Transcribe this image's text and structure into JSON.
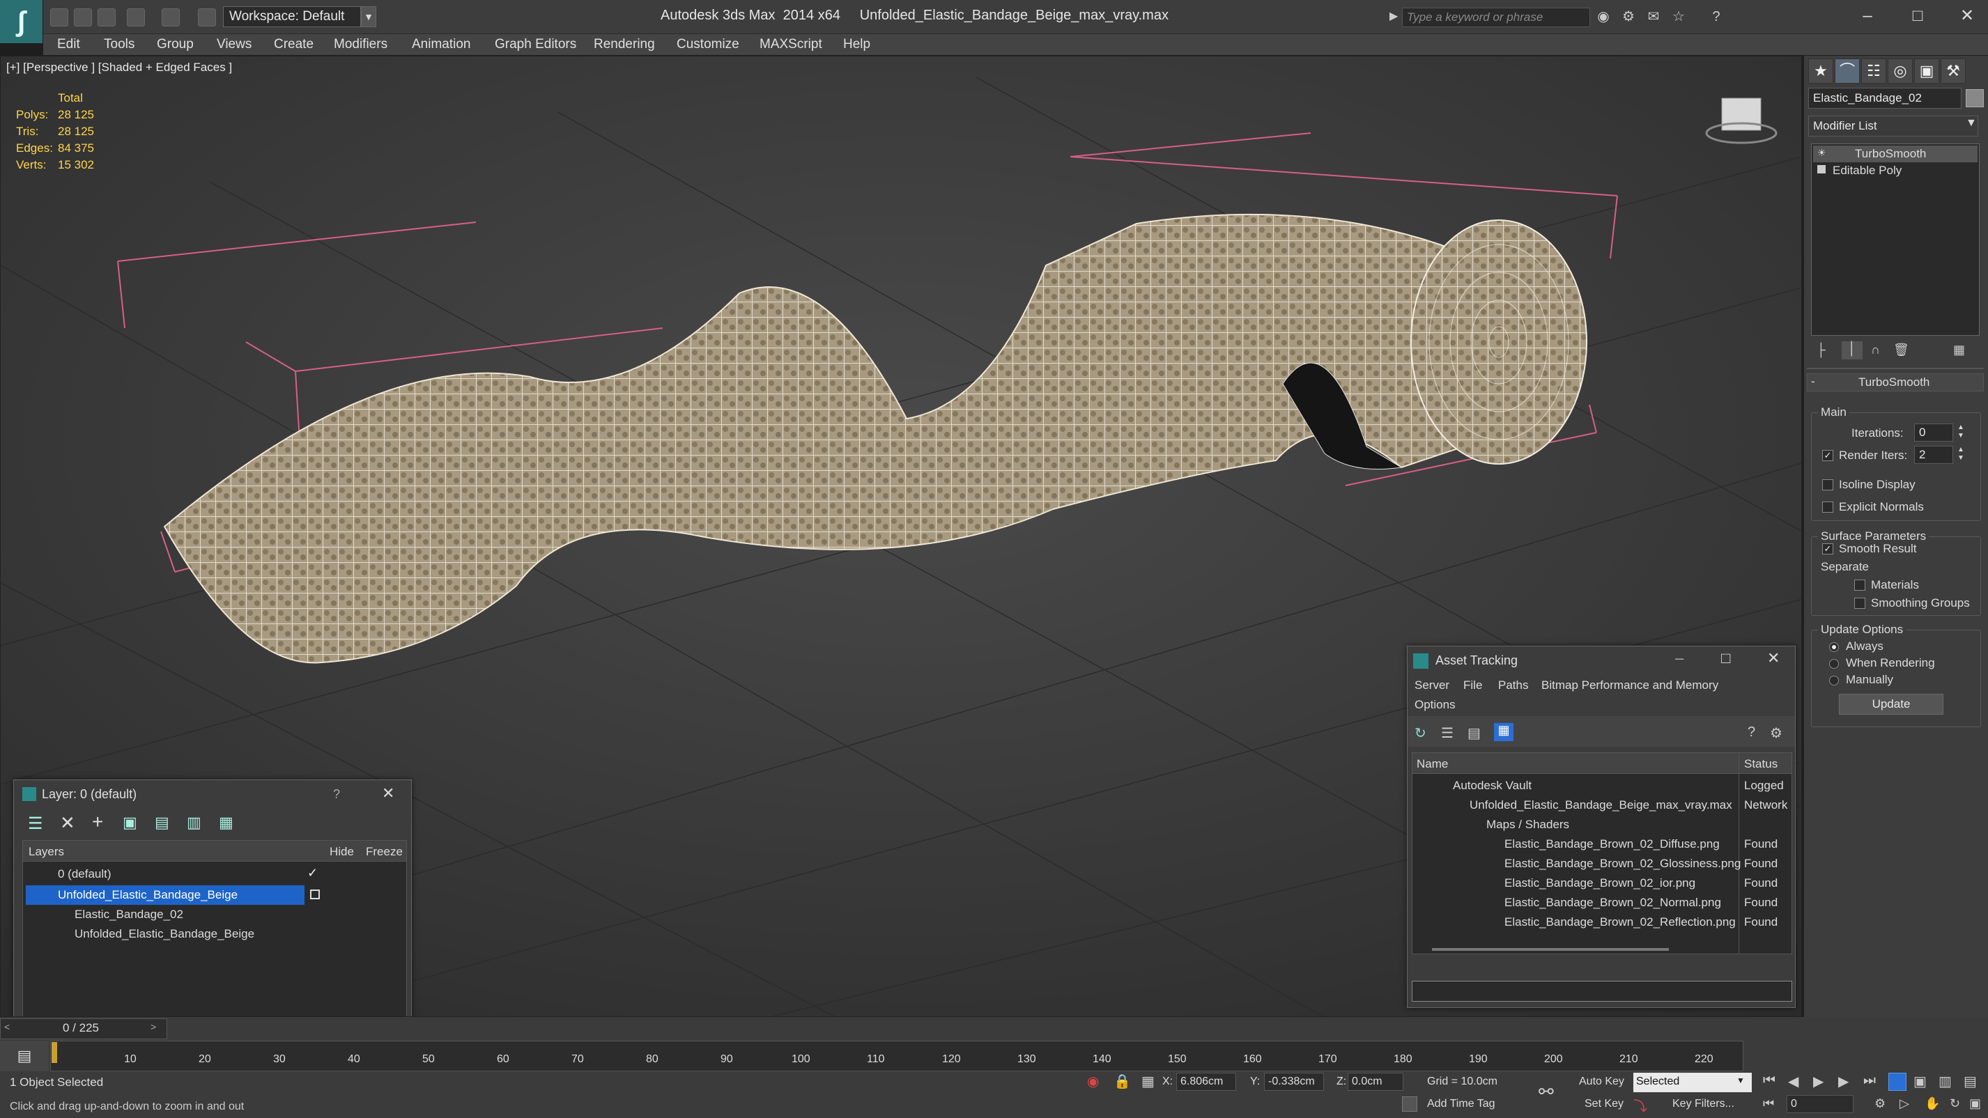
{
  "app": {
    "title": "Autodesk 3ds Max  2014 x64     Unfolded_Elastic_Bandage_Beige_max_vray.max",
    "workspace": "Workspace: Default",
    "search_placeholder": "Type a keyword or phrase"
  },
  "menu": [
    "Edit",
    "Tools",
    "Group",
    "Views",
    "Create",
    "Modifiers",
    "Animation",
    "Graph Editors",
    "Rendering",
    "Customize",
    "MAXScript",
    "Help"
  ],
  "viewport": {
    "label": "[+] [Perspective ] [Shaded + Edged Faces ]",
    "stats": {
      "header": "Total",
      "rows": [
        {
          "label": "Polys:",
          "value": "28 125"
        },
        {
          "label": "Tris:",
          "value": "28 125"
        },
        {
          "label": "Edges:",
          "value": "84 375"
        },
        {
          "label": "Verts:",
          "value": "15 302"
        }
      ]
    }
  },
  "command_panel": {
    "object_name": "Elastic_Bandage_02",
    "modifier_list": "Modifier List",
    "stack": [
      "TurboSmooth",
      "Editable Poly"
    ],
    "rollout_title": "TurboSmooth",
    "main_label": "Main",
    "iterations_label": "Iterations:",
    "iterations_value": "0",
    "render_iters_label": "Render Iters:",
    "render_iters_value": "2",
    "isoline": "Isoline Display",
    "explicit_normals": "Explicit Normals",
    "surface_params": "Surface Parameters",
    "smooth_result": "Smooth Result",
    "separate": "Separate",
    "materials": "Materials",
    "smoothing_groups": "Smoothing Groups",
    "update_options": "Update Options",
    "always": "Always",
    "when_rendering": "When Rendering",
    "manually": "Manually",
    "update_btn": "Update"
  },
  "layer_panel": {
    "title": "Layer: 0 (default)",
    "help": "?",
    "col_layers": "Layers",
    "col_hide": "Hide",
    "col_freeze": "Freeze",
    "rows": [
      "0 (default)",
      "Unfolded_Elastic_Bandage_Beige",
      "Elastic_Bandage_02",
      "Unfolded_Elastic_Bandage_Beige"
    ]
  },
  "asset_panel": {
    "title": "Asset Tracking",
    "menu": [
      "Server",
      "File",
      "Paths",
      "Bitmap Performance and Memory",
      "Options"
    ],
    "col_name": "Name",
    "col_status": "Status",
    "rows": [
      {
        "name": "Autodesk Vault",
        "status": "Logged"
      },
      {
        "name": "Unfolded_Elastic_Bandage_Beige_max_vray.max",
        "status": "Network"
      },
      {
        "name": "Maps / Shaders",
        "status": ""
      },
      {
        "name": "Elastic_Bandage_Brown_02_Diffuse.png",
        "status": "Found"
      },
      {
        "name": "Elastic_Bandage_Brown_02_Glossiness.png",
        "status": "Found"
      },
      {
        "name": "Elastic_Bandage_Brown_02_ior.png",
        "status": "Found"
      },
      {
        "name": "Elastic_Bandage_Brown_02_Normal.png",
        "status": "Found"
      },
      {
        "name": "Elastic_Bandage_Brown_02_Reflection.png",
        "status": "Found"
      }
    ]
  },
  "timeline": {
    "frame": "0 / 225",
    "ticks": [
      "10",
      "20",
      "30",
      "40",
      "50",
      "60",
      "70",
      "80",
      "90",
      "100",
      "110",
      "120",
      "130",
      "140",
      "150",
      "160",
      "170",
      "180",
      "190",
      "200",
      "210",
      "220"
    ]
  },
  "status": {
    "selected": "1 Object Selected",
    "hint": "Click and drag up-and-down to zoom in and out",
    "x_label": "X:",
    "x_value": "6.806cm",
    "y_label": "Y:",
    "y_value": "-0.338cm",
    "z_label": "Z:",
    "z_value": "0.0cm",
    "grid": "Grid = 10.0cm",
    "auto_key": "Auto Key",
    "selected_dropdown": "Selected",
    "set_key": "Set Key",
    "key_filters": "Key Filters...",
    "add_time_tag": "Add Time Tag",
    "frame_field": "0"
  }
}
